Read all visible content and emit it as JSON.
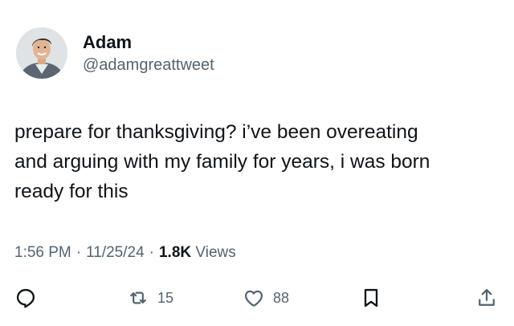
{
  "author": {
    "display_name": "Adam",
    "handle": "@adamgreattweet"
  },
  "tweet": {
    "text": "prepare for thanksgiving? i’ve been overeating\nand arguing with my family for years, i was born\nready for this"
  },
  "meta": {
    "time": "1:56 PM",
    "separator": "·",
    "date": "11/25/24",
    "views_count": "1.8K",
    "views_label": "Views"
  },
  "actions": {
    "reply_icon": "reply-icon",
    "retweet_icon": "retweet-icon",
    "retweet_count": "15",
    "like_icon": "heart-icon",
    "like_count": "88",
    "bookmark_icon": "bookmark-icon",
    "share_icon": "share-icon"
  },
  "colors": {
    "primary_text": "#0f1419",
    "secondary_text": "#536471",
    "background": "#ffffff"
  }
}
